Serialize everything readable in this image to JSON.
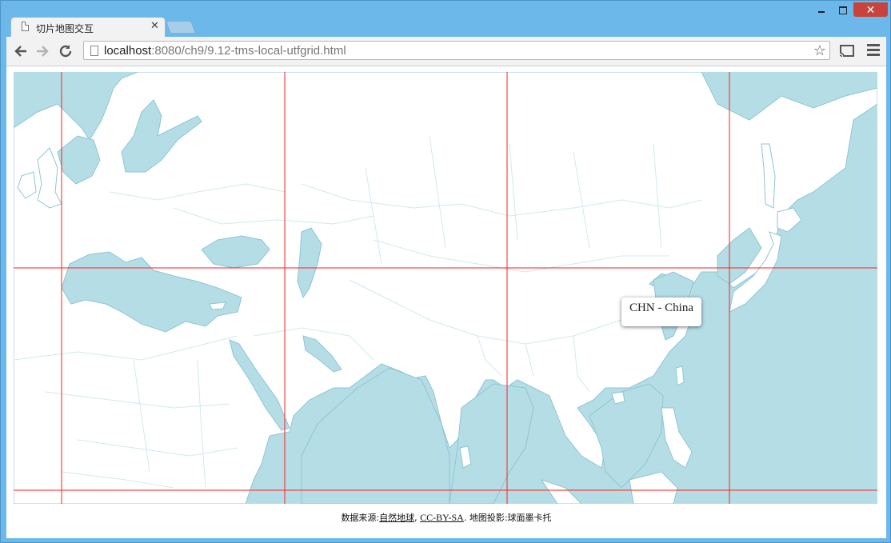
{
  "browser": {
    "tab_title": "切片地图交互",
    "tab_close_glyph": "✕",
    "url_host": "localhost",
    "url_rest": ":8080/ch9/9.12-tms-local-utfgrid.html",
    "bookmark_glyph": "☆"
  },
  "map": {
    "tooltip": "CHN - China",
    "colors": {
      "water": "#b5dde5",
      "land": "#ffffff",
      "border": "#d4e8ec",
      "coast": "#8fc6d3",
      "grid": "#ff1f1f"
    }
  },
  "attribution": {
    "prefix": "数据来源:",
    "source_link": "自然地球",
    "sep1": ", ",
    "license_link": "CC-BY-SA",
    "suffix": ". 地图投影:球面墨卡托"
  }
}
